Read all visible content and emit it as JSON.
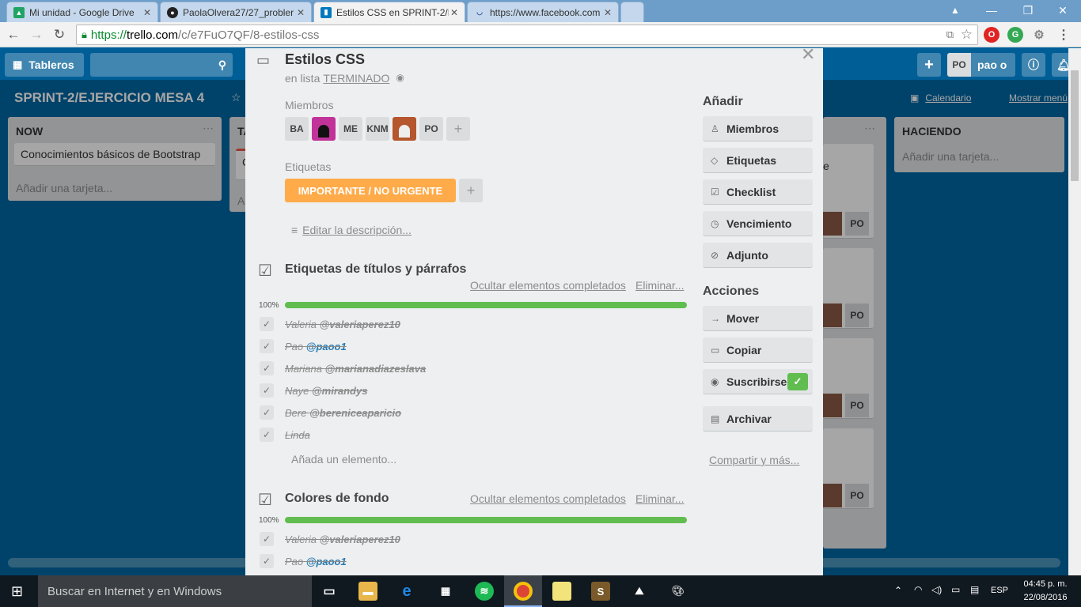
{
  "browser": {
    "tabs": [
      {
        "title": "Mi unidad - Google Drive",
        "icon": "google-drive-icon",
        "color": "#1fa463"
      },
      {
        "title": "PaolaOlvera27/27_probler",
        "icon": "github-icon",
        "color": "#222222"
      },
      {
        "title": "Estilos CSS en SPRINT-2/E",
        "icon": "trello-icon",
        "color": "#0079bf"
      },
      {
        "title": "https://www.facebook.com",
        "icon": "loading-icon",
        "color": "#3b5998"
      }
    ],
    "url_scheme": "https://",
    "url_host": "trello.com",
    "url_path": "/c/e7FuO7QF/8-estilos-css"
  },
  "header": {
    "boards_label": "Tableros",
    "user_initials": "PO",
    "user_name": "pao o"
  },
  "board": {
    "title": "SPRINT-2/EJERCICIO MESA 4",
    "calendar_label": "Calendario",
    "show_menu_label": "Mostrar menú",
    "lists": [
      {
        "name": "NOW",
        "cards": [
          "Conocimientos básicos de Bootstrap"
        ],
        "add_label": "Añadir una tarjeta..."
      },
      {
        "name": "TA",
        "cards": [
          "C"
        ],
        "add_label": "A"
      },
      {
        "name": "HACIENDO",
        "cards": [],
        "add_label": "Añadir una tarjeta..."
      }
    ],
    "partial_card_text": "e",
    "partial_badges": [
      "PO",
      "PO",
      "PO",
      "PO"
    ]
  },
  "card": {
    "title": "Estilos CSS",
    "in_list_prefix": "en lista",
    "list_name": "TERMINADO",
    "members_label": "Miembros",
    "members": [
      "BA",
      "",
      "ME",
      "KNM",
      "",
      "PO"
    ],
    "labels_label": "Etiquetas",
    "label_text": "IMPORTANTE / NO URGENTE",
    "label_color": "#ffab4a",
    "edit_description": "Editar la descripción...",
    "checklists": [
      {
        "title": "Etiquetas de títulos y párrafos",
        "hide_completed": "Ocultar elementos completados",
        "delete": "Eliminar...",
        "percent": "100%",
        "progress": 1.0,
        "items": [
          {
            "text": "Valeria",
            "mention": "@valeriaperez10",
            "link": false
          },
          {
            "text": "Pao",
            "mention": "@paoo1",
            "link": true
          },
          {
            "text": "Mariana",
            "mention": "@marianadiazeslava",
            "link": false
          },
          {
            "text": "Naye",
            "mention": "@mirandys",
            "link": false
          },
          {
            "text": "Bere",
            "mention": "@bereniceaparicio",
            "link": false
          },
          {
            "text": "Linda",
            "mention": "",
            "link": false
          }
        ],
        "add_item": "Añada un elemento..."
      },
      {
        "title": "Colores de fondo",
        "hide_completed": "Ocultar elementos completados",
        "delete": "Eliminar...",
        "percent": "100%",
        "progress": 1.0,
        "items": [
          {
            "text": "Valeria",
            "mention": "@valeriaperez10",
            "link": false
          },
          {
            "text": "Pao",
            "mention": "@paoo1",
            "link": true
          }
        ]
      }
    ],
    "add_section": {
      "title": "Añadir",
      "buttons": [
        {
          "label": "Miembros",
          "icon": "person-icon"
        },
        {
          "label": "Etiquetas",
          "icon": "tag-icon"
        },
        {
          "label": "Checklist",
          "icon": "checkbox-icon"
        },
        {
          "label": "Vencimiento",
          "icon": "clock-icon"
        },
        {
          "label": "Adjunto",
          "icon": "paperclip-icon"
        }
      ]
    },
    "actions_section": {
      "title": "Acciones",
      "buttons": [
        {
          "label": "Mover",
          "icon": "arrow-right-icon"
        },
        {
          "label": "Copiar",
          "icon": "card-icon"
        },
        {
          "label": "Suscribirse",
          "icon": "eye-icon"
        },
        {
          "label": "Archivar",
          "icon": "archive-icon"
        }
      ],
      "share_label": "Compartir y más..."
    }
  },
  "taskbar": {
    "search_placeholder": "Buscar en Internet y en Windows",
    "language": "ESP",
    "time": "04:45 p. m.",
    "date": "22/08/2016"
  }
}
